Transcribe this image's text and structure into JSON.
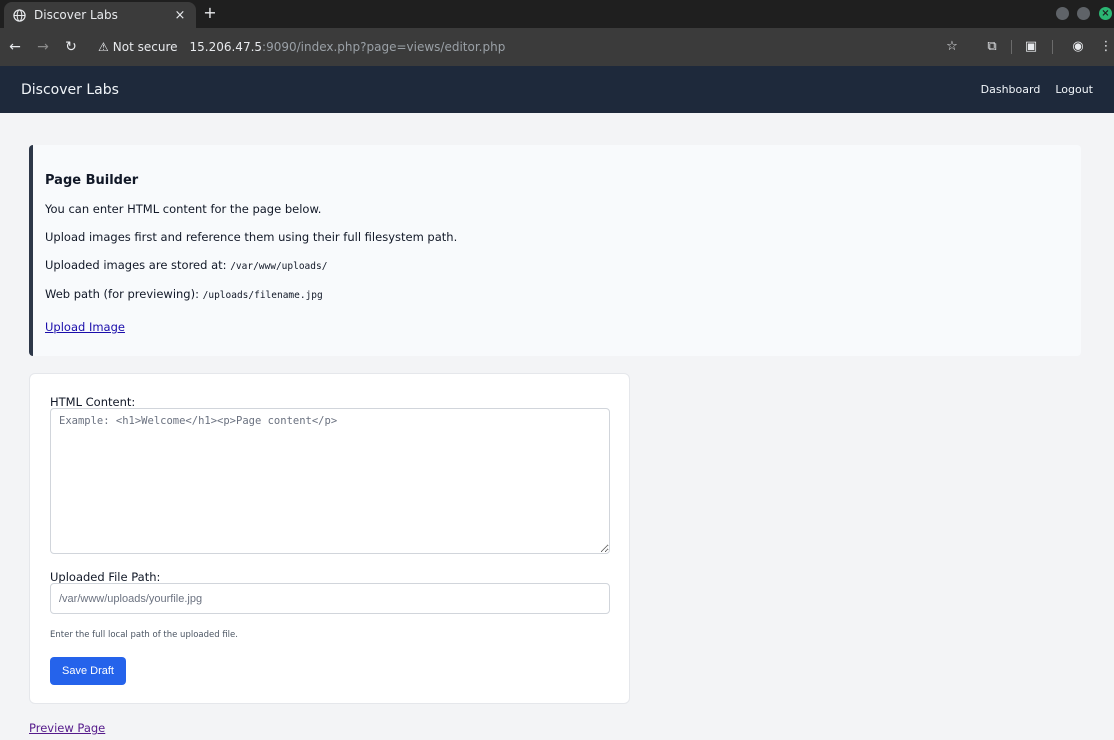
{
  "browser": {
    "tab_title": "Discover Labs",
    "tab_close": "×",
    "new_tab": "+",
    "security_label": "Not secure",
    "url_host": "15.206.47.5",
    "url_rest": ":9090/index.php?page=views/editor.php"
  },
  "navbar": {
    "brand": "Discover Labs",
    "links": [
      "Dashboard",
      "Logout"
    ]
  },
  "info_panel": {
    "title": "Page Builder",
    "line1": "You can enter HTML content for the page below.",
    "line2": "Upload images first and reference them using their full filesystem path.",
    "line3_text": "Uploaded images are stored at: ",
    "line3_code": "/var/www/uploads/",
    "line4_text": "Web path (for previewing): ",
    "line4_code": "/uploads/filename.jpg",
    "upload_link": "Upload Image"
  },
  "form": {
    "html_label": "HTML Content:",
    "html_placeholder": "Example: <h1>Welcome</h1><p>Page content</p>",
    "html_value": "",
    "path_label": "Uploaded File Path:",
    "path_placeholder": "/var/www/uploads/yourfile.jpg",
    "path_value": "",
    "path_hint": "Enter the full local path of the uploaded file.",
    "save_label": "Save Draft"
  },
  "footer": {
    "preview_link": "Preview Page"
  },
  "colors": {
    "navbar_bg": "#1e293b",
    "accent": "#2563eb",
    "panel_border": "#2d3748"
  }
}
